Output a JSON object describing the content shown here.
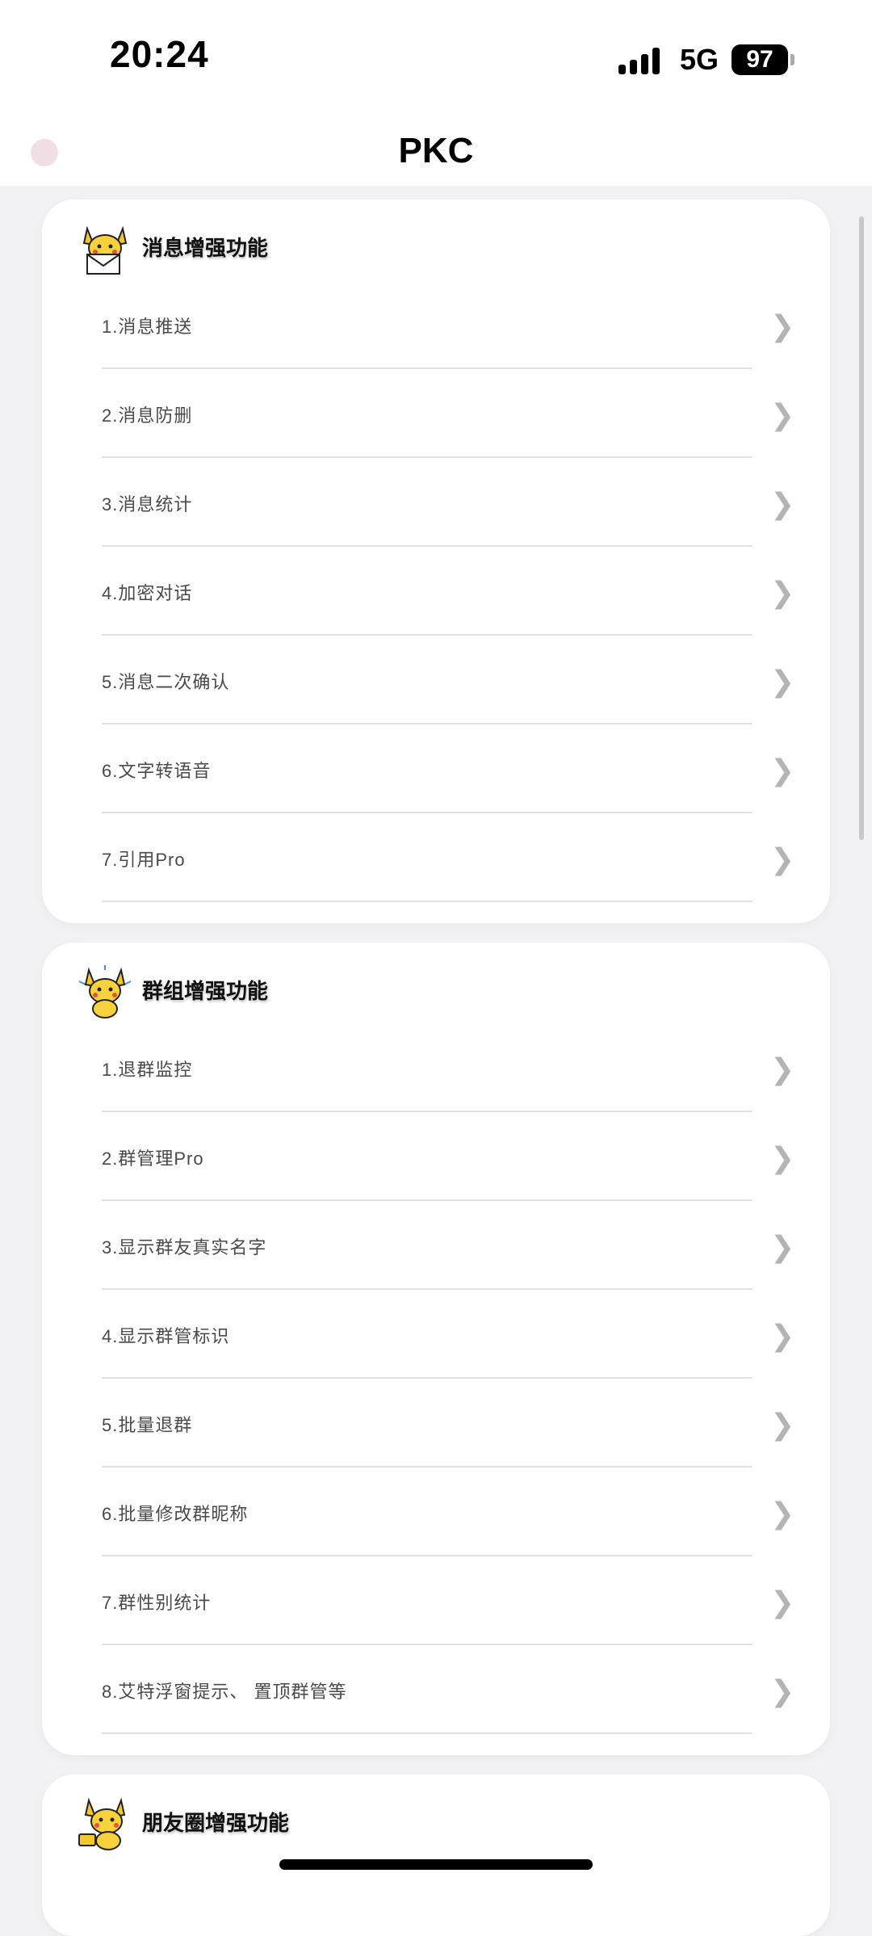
{
  "status_bar": {
    "time": "20:24",
    "network": "5G",
    "battery": "97"
  },
  "header": {
    "title": "PKC"
  },
  "sections": [
    {
      "title": "消息增强功能",
      "icon": "pikachu-mail-icon",
      "items": [
        "1.消息推送",
        "2.消息防删",
        "3.消息统计",
        "4.加密对话",
        "5.消息二次确认",
        "6.文字转语音",
        "7.引用Pro"
      ]
    },
    {
      "title": "群组增强功能",
      "icon": "pikachu-sparkle-icon",
      "items": [
        "1.退群监控",
        "2.群管理Pro",
        "3.显示群友真实名字",
        "4.显示群管标识",
        "5.批量退群",
        "6.批量修改群昵称",
        "7.群性别统计",
        "8.艾特浮窗提示、 置顶群管等"
      ]
    },
    {
      "title": "朋友圈增强功能",
      "icon": "pikachu-card-icon",
      "items": []
    }
  ],
  "colors": {
    "accent": "#f4c72a",
    "background": "#f2f2f4",
    "chevron": "#b4b4b4"
  }
}
